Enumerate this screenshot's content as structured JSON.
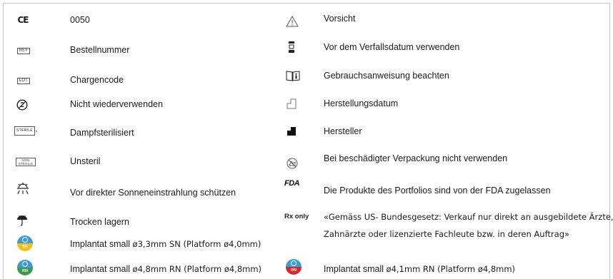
{
  "left": [
    {
      "icon": "ce-mark-icon",
      "symbol": "CE",
      "label": "0050"
    },
    {
      "icon": "ref-icon",
      "symbol": "REF",
      "label": "Bestellnummer"
    },
    {
      "icon": "lot-icon",
      "symbol": "LOT",
      "label": "Chargencode"
    },
    {
      "icon": "do-not-reuse-icon",
      "symbol": "2",
      "label": "Nicht wiederverwenden"
    },
    {
      "icon": "steam-sterilized-icon",
      "symbol": "STERILE",
      "label": "Dampfsterilisiert"
    },
    {
      "icon": "non-sterile-icon",
      "symbol": "NON STERILE",
      "label": "Unsteril"
    },
    {
      "icon": "keep-away-from-sunlight-icon",
      "label": "Vor direkter Sonneneinstrahlung schützen"
    },
    {
      "icon": "keep-dry-icon",
      "label": "Trocken lagern"
    },
    {
      "icon": "sn-badge-icon",
      "symbol": "SN",
      "label_bold": "Implantat small",
      "label_rest": "ø3,3mm SN (Platform ø4,0mm)",
      "color": "#f2c01e"
    },
    {
      "icon": "rn-badge-icon",
      "symbol": "RN",
      "label_bold": "Implantat small",
      "label_rest": "ø4,8mm RN (Platform ø4,8mm)",
      "color": "#3c9b4a"
    }
  ],
  "right": [
    {
      "icon": "caution-icon",
      "label": "Vorsicht"
    },
    {
      "icon": "use-by-date-icon",
      "label": "Vor dem Verfallsdatum verwenden"
    },
    {
      "icon": "consult-instructions-icon",
      "label": "Gebrauchsanweisung beachten"
    },
    {
      "icon": "date-of-manufacture-icon",
      "label": "Herstellungsdatum"
    },
    {
      "icon": "manufacturer-icon",
      "label": "Hersteller"
    },
    {
      "icon": "do-not-use-if-damaged-icon",
      "label": "Bei beschädigter Verpackung nicht verwenden"
    },
    {
      "icon": "fda-logo",
      "symbol": "FDA",
      "label": "Die Produkte des Portfolios sind von der FDA zugelassen"
    },
    {
      "icon": "rx-only-icon",
      "symbol": "Rx only",
      "label_line1": "«Gemäss US- Bundesgesetz: Verkauf nur direkt an ausgebildete Ärzte,",
      "label_line2": "Zahnärzte oder lizenzierte Fachleute bzw. in deren Auftrag»"
    },
    {
      "icon": "rn-red-badge-icon",
      "symbol": "RN",
      "label_bold": "Implantat small",
      "label_rest": "ø4,1mm RN (Platform ø4,8mm)",
      "color": "#d9262b"
    }
  ]
}
